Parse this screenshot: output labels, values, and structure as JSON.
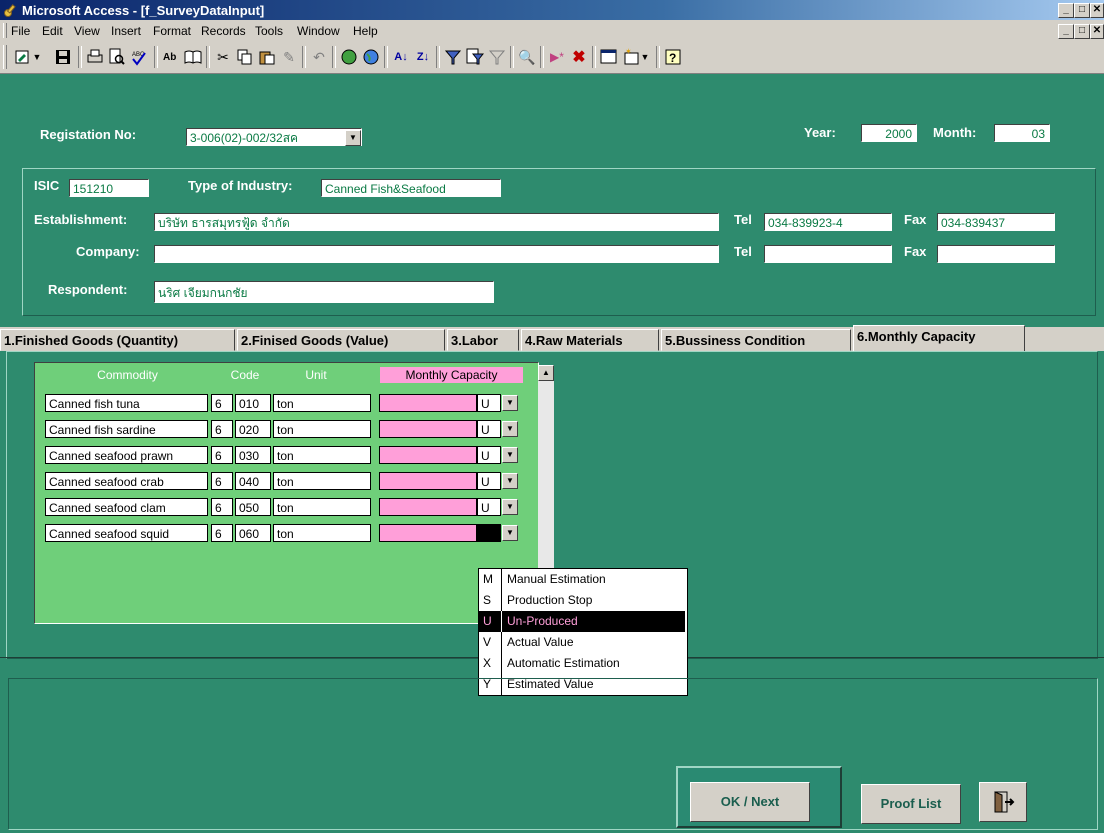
{
  "window": {
    "title": "Microsoft Access - [f_SurveyDataInput]"
  },
  "menu": {
    "items": [
      "File",
      "Edit",
      "View",
      "Insert",
      "Format",
      "Records",
      "Tools",
      "Window",
      "Help"
    ]
  },
  "header": {
    "registration_label": "Registation No:",
    "registration_value": "3-006(02)-002/32สค",
    "year_label": "Year:",
    "year_value": "2000",
    "month_label": "Month:",
    "month_value": "03"
  },
  "info": {
    "isic_label": "ISIC",
    "isic_value": "151210",
    "industry_label": "Type of Industry:",
    "industry_value": "Canned Fish&Seafood",
    "establishment_label": "Establishment:",
    "establishment_value": "บริษัท ธารสมุทรฟู้ด จำกัด",
    "tel_label": "Tel",
    "tel_value": "034-839923-4",
    "fax_label": "Fax",
    "fax_value": "034-839437",
    "company_label": "Company:",
    "company_value": "",
    "tel2_label": "Tel",
    "tel2_value": "",
    "fax2_label": "Fax",
    "fax2_value": "",
    "respondent_label": "Respondent:",
    "respondent_value": "นริศ เจียมกนกชัย"
  },
  "tabs": [
    {
      "label": "1.Finished Goods (Quantity)"
    },
    {
      "label": "2.Finised Goods (Value)"
    },
    {
      "label": "3.Labor"
    },
    {
      "label": "4.Raw Materials"
    },
    {
      "label": "5.Bussiness Condition"
    },
    {
      "label": "6.Monthly Capacity"
    }
  ],
  "grid": {
    "headers": {
      "commodity": "Commodity",
      "code": "Code",
      "unit": "Unit",
      "capacity": "Monthly Capacity"
    },
    "rows": [
      {
        "commodity": "Canned fish tuna",
        "code_a": "6",
        "code_b": "010",
        "unit": "ton",
        "flag": "U"
      },
      {
        "commodity": "Canned fish sardine",
        "code_a": "6",
        "code_b": "020",
        "unit": "ton",
        "flag": "U"
      },
      {
        "commodity": "Canned seafood prawn",
        "code_a": "6",
        "code_b": "030",
        "unit": "ton",
        "flag": "U"
      },
      {
        "commodity": "Canned seafood crab",
        "code_a": "6",
        "code_b": "040",
        "unit": "ton",
        "flag": "U"
      },
      {
        "commodity": "Canned seafood  clam",
        "code_a": "6",
        "code_b": "050",
        "unit": "ton",
        "flag": "U"
      },
      {
        "commodity": "Canned seafood squid",
        "code_a": "6",
        "code_b": "060",
        "unit": "ton",
        "flag": ""
      }
    ]
  },
  "dropdown": {
    "options": [
      {
        "key": "M",
        "value": "Manual Estimation"
      },
      {
        "key": "S",
        "value": "Production Stop"
      },
      {
        "key": "U",
        "value": "Un-Produced"
      },
      {
        "key": "V",
        "value": "Actual Value"
      },
      {
        "key": "X",
        "value": "Automatic Estimation"
      },
      {
        "key": "Y",
        "value": "Estimated Value"
      }
    ],
    "selected": "U"
  },
  "buttons": {
    "ok_next": "OK / Next",
    "proof_list": "Proof List"
  },
  "colors": {
    "form_bg": "#2e8b6e",
    "subform_bg": "#6fcf7a",
    "capacity_cell": "#ff9fd9",
    "field_text": "#0a7a44"
  }
}
